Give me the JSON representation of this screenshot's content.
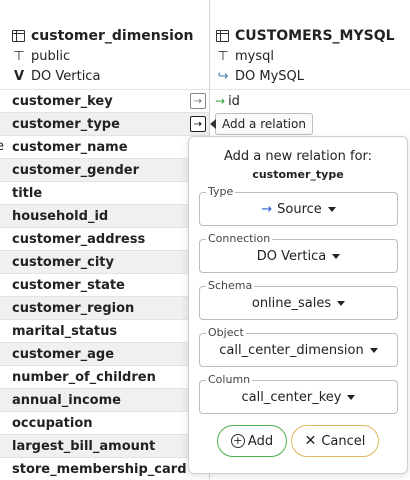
{
  "left_table": {
    "title": "customer_dimension",
    "schema": "public",
    "connection": "DO Vertica",
    "columns": [
      "customer_key",
      "customer_type",
      "customer_name",
      "customer_gender",
      "title",
      "household_id",
      "customer_address",
      "customer_city",
      "customer_state",
      "customer_region",
      "marital_status",
      "customer_age",
      "number_of_children",
      "annual_income",
      "occupation",
      "largest_bill_amount",
      "store_membership_card"
    ],
    "edge_char": "e"
  },
  "right_table": {
    "title": "CUSTOMERS_MYSQL",
    "schema": "mysql",
    "connection": "DO MySQL",
    "columns": [
      "id"
    ]
  },
  "tooltip": "Add a relation",
  "popup": {
    "title": "Add a new relation for:",
    "subtitle": "customer_type",
    "fields": {
      "type": {
        "label": "Type",
        "value": "Source"
      },
      "connection": {
        "label": "Connection",
        "value": "DO Vertica"
      },
      "schema": {
        "label": "Schema",
        "value": "online_sales"
      },
      "object": {
        "label": "Object",
        "value": "call_center_dimension"
      },
      "column": {
        "label": "Column",
        "value": "call_center_key"
      }
    },
    "add_label": "Add",
    "cancel_label": "Cancel"
  },
  "colors": {
    "source_arrow": "#2d5fd3",
    "link_arrow": "#2e9e3a",
    "add_border": "#4caf50",
    "cancel_border": "#e0b860"
  },
  "icons": [
    "table-icon",
    "schema-icon",
    "vertica-icon",
    "mysql-icon",
    "add-relation-icon",
    "plus-circle-icon",
    "close-icon",
    "chevron-down-icon",
    "arrow-right-icon"
  ]
}
